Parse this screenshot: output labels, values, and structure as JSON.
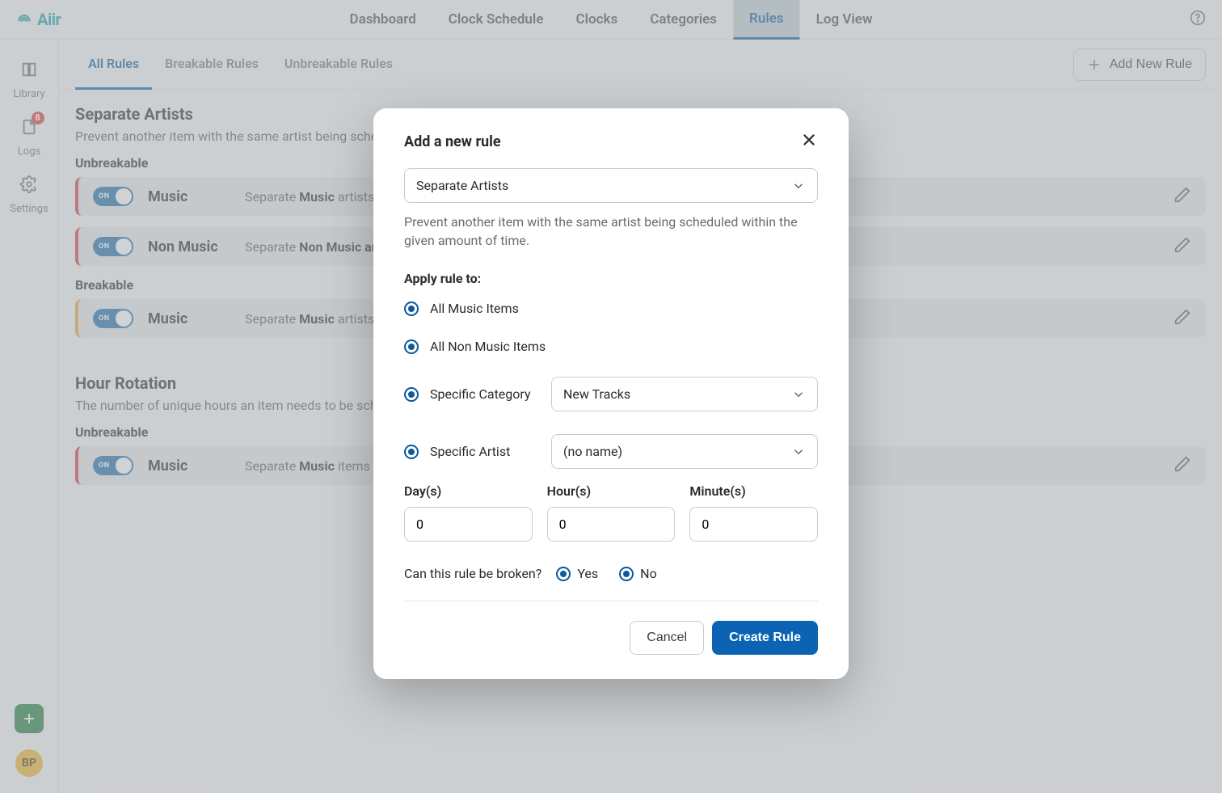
{
  "brand": {
    "name": "Aiir"
  },
  "topnav": {
    "items": [
      "Dashboard",
      "Clock Schedule",
      "Clocks",
      "Categories",
      "Rules",
      "Log View"
    ],
    "active_index": 4
  },
  "leftbar": {
    "items": [
      {
        "label": "Library",
        "icon": "book-icon"
      },
      {
        "label": "Logs",
        "icon": "file-icon",
        "badge": "8"
      },
      {
        "label": "Settings",
        "icon": "gear-icon"
      }
    ],
    "avatar_initials": "BP"
  },
  "subtabs": {
    "items": [
      "All Rules",
      "Breakable Rules",
      "Unbreakable Rules"
    ],
    "active_index": 0,
    "add_button_label": "Add New Rule"
  },
  "sections": [
    {
      "title": "Separate Artists",
      "desc": "Prevent another item with the same artist being scheduled",
      "groups": [
        {
          "label": "Unbreakable",
          "rows": [
            {
              "name": "Music",
              "desc_prefix": "Separate ",
              "desc_bold": "Music",
              "desc_suffix": " artists by "
            },
            {
              "name": "Non Music",
              "desc_prefix": "Separate ",
              "desc_bold": "Non Music artists",
              "desc_suffix": ""
            }
          ]
        },
        {
          "label": "Breakable",
          "rows": [
            {
              "name": "Music",
              "desc_prefix": "Separate ",
              "desc_bold": "Music",
              "desc_suffix": " artists by "
            }
          ]
        }
      ]
    },
    {
      "title": "Hour Rotation",
      "desc": "The number of unique hours an item needs to be scheduled",
      "groups": [
        {
          "label": "Unbreakable",
          "rows": [
            {
              "name": "Music",
              "desc_prefix": "Separate ",
              "desc_bold": "Music",
              "desc_suffix": " items by u"
            }
          ]
        }
      ]
    }
  ],
  "toggle_text": "ON",
  "modal": {
    "title": "Add a new rule",
    "rule_type_value": "Separate Artists",
    "hint": "Prevent another item with the same artist being scheduled within the given amount of time.",
    "apply_rule_heading": "Apply rule to:",
    "radio_options": [
      {
        "label": "All Music Items"
      },
      {
        "label": "All Non Music Items"
      },
      {
        "label": "Specific Category",
        "select_value": "New Tracks"
      },
      {
        "label": "Specific Artist",
        "select_value": "(no name)"
      }
    ],
    "time_labels": {
      "days": "Day(s)",
      "hours": "Hour(s)",
      "minutes": "Minute(s)"
    },
    "time_values": {
      "days": "0",
      "hours": "0",
      "minutes": "0"
    },
    "broken_question": "Can this rule be broken?",
    "broken_yes": "Yes",
    "broken_no": "No",
    "cancel_label": "Cancel",
    "submit_label": "Create Rule"
  }
}
